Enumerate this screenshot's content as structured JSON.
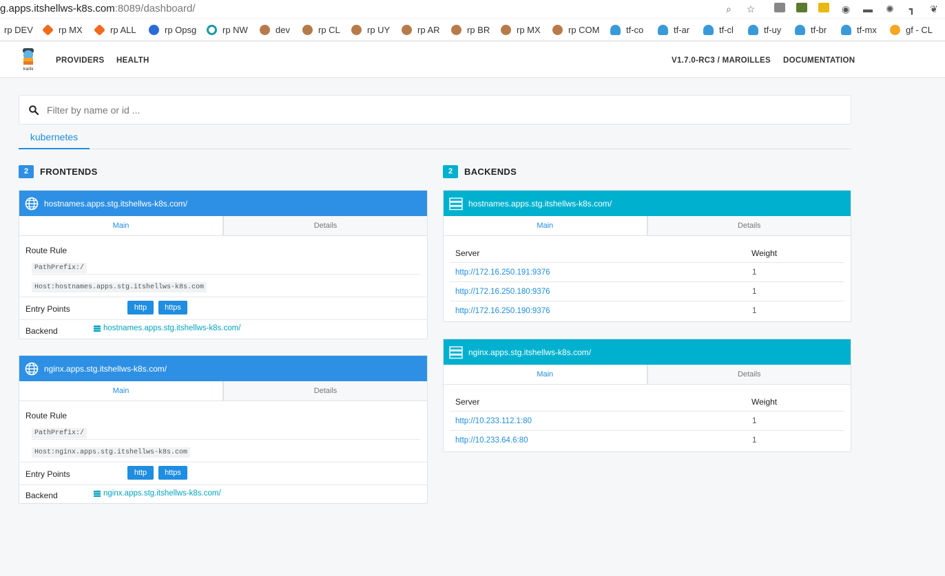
{
  "browser": {
    "url_host": "g.apps.itshellws-k8s.com",
    "url_rest": ":8089/dashboard/",
    "bookmarks": [
      {
        "label": "rp DEV",
        "color": "#ffffff"
      },
      {
        "label": "rp MX",
        "color": "#f26b1d"
      },
      {
        "label": "rp ALL",
        "color": "#f26b1d"
      },
      {
        "label": "rp Opsg",
        "color": "#2a6bd6"
      },
      {
        "label": "rp NW",
        "color": "#1a9aa0"
      },
      {
        "label": "dev",
        "color": "#b77b4a"
      },
      {
        "label": "rp CL",
        "color": "#b77b4a"
      },
      {
        "label": "rp UY",
        "color": "#b77b4a"
      },
      {
        "label": "rp AR",
        "color": "#b77b4a"
      },
      {
        "label": "rp BR",
        "color": "#b77b4a"
      },
      {
        "label": "rp MX",
        "color": "#b77b4a"
      },
      {
        "label": "rp COM",
        "color": "#b77b4a"
      },
      {
        "label": "tf-co",
        "color": "#3a9ad9"
      },
      {
        "label": "tf-ar",
        "color": "#3a9ad9"
      },
      {
        "label": "tf-cl",
        "color": "#3a9ad9"
      },
      {
        "label": "tf-uy",
        "color": "#3a9ad9"
      },
      {
        "label": "tf-br",
        "color": "#3a9ad9"
      },
      {
        "label": "tf-mx",
        "color": "#3a9ad9"
      },
      {
        "label": "gf - CL",
        "color": "#f5a623"
      }
    ]
  },
  "nav": {
    "providers": "PROVIDERS",
    "health": "HEALTH",
    "version": "V1.7.0-RC3 / MAROILLES",
    "documentation": "DOCUMENTATION"
  },
  "filter": {
    "placeholder": "Filter by name or id ..."
  },
  "provider_tab": "kubernetes",
  "frontends": {
    "count": "2",
    "title": "FRONTENDS",
    "items": [
      {
        "name": "hostnames.apps.stg.itshellws-k8s.com/",
        "tab_main": "Main",
        "tab_details": "Details",
        "route_rule_label": "Route Rule",
        "rule1": "PathPrefix:/",
        "rule2": "Host:hostnames.apps.stg.itshellws-k8s.com",
        "entry_points_label": "Entry Points",
        "ep1": "http",
        "ep2": "https",
        "backend_label": "Backend",
        "backend": "hostnames.apps.stg.itshellws-k8s.com/"
      },
      {
        "name": "nginx.apps.stg.itshellws-k8s.com/",
        "tab_main": "Main",
        "tab_details": "Details",
        "route_rule_label": "Route Rule",
        "rule1": "PathPrefix:/",
        "rule2": "Host:nginx.apps.stg.itshellws-k8s.com",
        "entry_points_label": "Entry Points",
        "ep1": "http",
        "ep2": "https",
        "backend_label": "Backend",
        "backend": "nginx.apps.stg.itshellws-k8s.com/"
      }
    ]
  },
  "backends": {
    "count": "2",
    "title": "BACKENDS",
    "items": [
      {
        "name": "hostnames.apps.stg.itshellws-k8s.com/",
        "tab_main": "Main",
        "tab_details": "Details",
        "col_server": "Server",
        "col_weight": "Weight",
        "servers": [
          {
            "url": "http://172.16.250.191:9376",
            "weight": "1"
          },
          {
            "url": "http://172.16.250.180:9376",
            "weight": "1"
          },
          {
            "url": "http://172.16.250.190:9376",
            "weight": "1"
          }
        ]
      },
      {
        "name": "nginx.apps.stg.itshellws-k8s.com/",
        "tab_main": "Main",
        "tab_details": "Details",
        "col_server": "Server",
        "col_weight": "Weight",
        "servers": [
          {
            "url": "http://10.233.112.1:80",
            "weight": "1"
          },
          {
            "url": "http://10.233.64.6:80",
            "weight": "1"
          }
        ]
      }
    ]
  },
  "colors": {
    "frontend_header": "#2e90e4",
    "backend_header": "#00b1cf",
    "accent": "#1f8de0"
  }
}
